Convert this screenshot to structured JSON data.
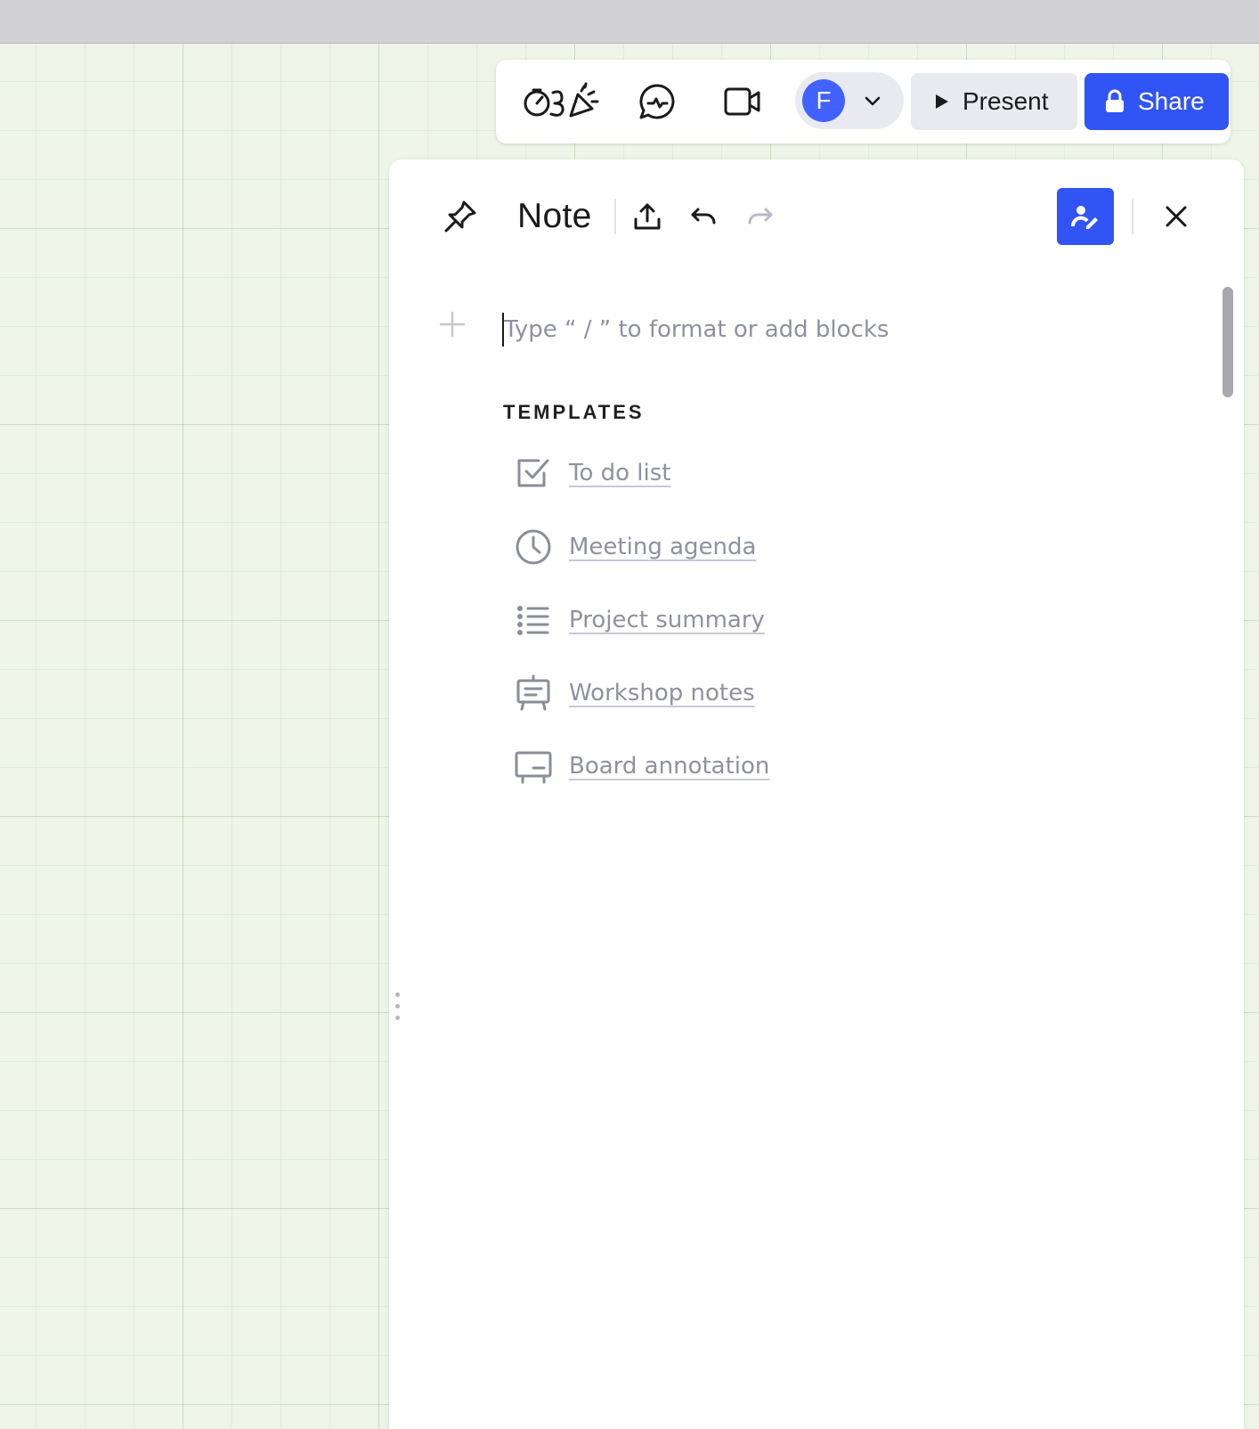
{
  "toolbar": {
    "reactions_icon": "timer-celebration-icon",
    "comments_icon": "chat-bubble-icon",
    "video_icon": "video-camera-icon",
    "user_initial": "F",
    "present_label": "Present",
    "share_label": "Share",
    "share_color": "#3154f5"
  },
  "note": {
    "title": "Note",
    "placeholder": "Type “ / ” to format or add blocks",
    "templates_heading": "TEMPLATES",
    "templates": [
      {
        "label": "To do list",
        "icon": "checkbox-icon"
      },
      {
        "label": "Meeting agenda",
        "icon": "clock-icon"
      },
      {
        "label": "Project summary",
        "icon": "bullet-list-icon"
      },
      {
        "label": "Workshop notes",
        "icon": "easel-icon"
      },
      {
        "label": "Board annotation",
        "icon": "board-icon"
      }
    ]
  }
}
